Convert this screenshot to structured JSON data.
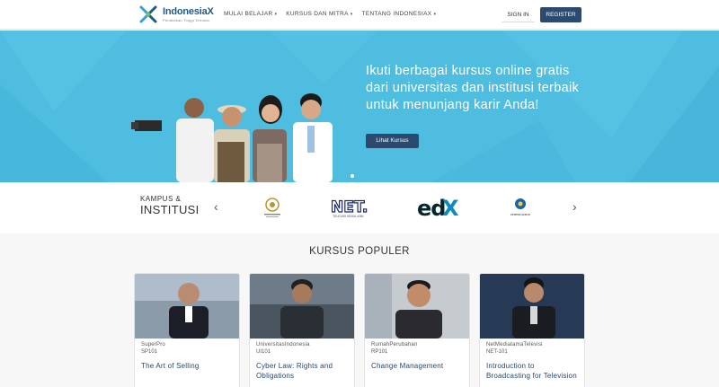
{
  "nav": {
    "brand": "IndonesiaX",
    "tagline": "Pendidikan Tinggi Terbuka",
    "menu": [
      {
        "label": "MULAI BELAJAR"
      },
      {
        "label": "KURSUS DAN MITRA"
      },
      {
        "label": "TENTANG INDONESIAX"
      }
    ],
    "caret": "▾",
    "signin_label": "SIGN IN",
    "register_label": "REGISTER"
  },
  "hero": {
    "title": "Ikuti berbagai kursus online gratis dari universitas dan institusi terbaik untuk menunjang karir Anda!",
    "button_label": "Lihat Kursus"
  },
  "partners": {
    "label_line1": "KAMPUS &",
    "label_line2": "INSTITUSI",
    "prev_arrow": "‹",
    "next_arrow": "›",
    "logos": [
      {
        "name": "ui-seal-logo",
        "text": "UI"
      },
      {
        "name": "net-logo",
        "text": "NET.",
        "subtext": "TELEVISI MASA KINI"
      },
      {
        "name": "edx-logo",
        "text": "edX"
      },
      {
        "name": "kemdikbud-logo",
        "text": "KEMENDIKBUD"
      }
    ]
  },
  "popular": {
    "title": "KURSUS POPULER",
    "courses": [
      {
        "org": "SuperPro",
        "code": "SP101",
        "title": "The Art of Selling"
      },
      {
        "org": "UniversitasIndonesia",
        "code": "UI101",
        "title": "Cyber Law: Rights and Obligations"
      },
      {
        "org": "RumahPerubahan",
        "code": "RP101",
        "title": "Change Management"
      },
      {
        "org": "NetMediatamaTelevisi",
        "code": "NET-101",
        "title": "Introduction to Broadcasting for Television"
      }
    ]
  },
  "colors": {
    "hero_bg": "#4fbde0",
    "brand_navy": "#2c4a6e",
    "link_blue": "#24486e"
  }
}
